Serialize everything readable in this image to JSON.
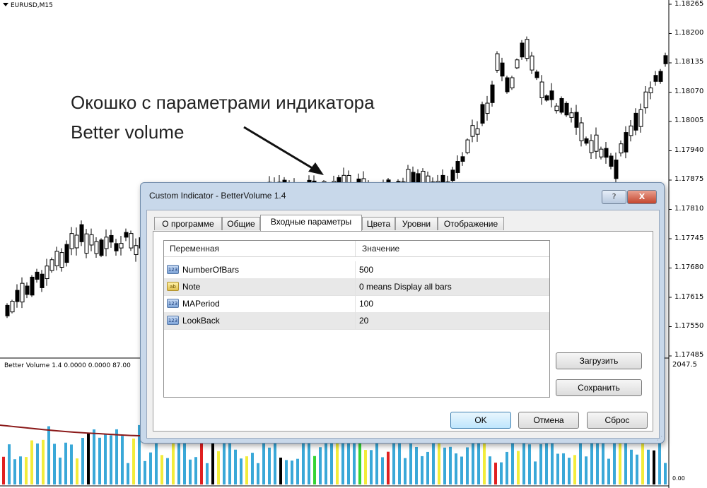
{
  "chart": {
    "symbol": "EURUSD,M15",
    "price_labels": [
      "1.18265",
      "1.18200",
      "1.18135",
      "1.18070",
      "1.18005",
      "1.17940",
      "1.17875",
      "1.17810",
      "1.17745",
      "1.17680",
      "1.17615",
      "1.17550",
      "1.17485"
    ],
    "indicator_label": "Better Volume 1.4 0.0000 0.0000 87.00",
    "indicator_right_label": "2047.5",
    "indicator_bottom_label": "0.00",
    "colors": {
      "bull": "#ffffff",
      "bear": "#000000",
      "volume_blue": "#3aa8d8",
      "volume_yellow": "#f2ec3a",
      "volume_red": "#e02020",
      "volume_green": "#35d435",
      "volume_black": "#000000",
      "ma_line": "#8b1a1a"
    }
  },
  "annotation": {
    "line1": "Окошко с параметрами индикатора",
    "line2": "Better volume"
  },
  "dialog": {
    "title": "Custom Indicator - BetterVolume 1.4",
    "help_label": "?",
    "close_label": "X",
    "tabs": [
      {
        "label": "О программе"
      },
      {
        "label": "Общие"
      },
      {
        "label": "Входные параметры",
        "active": true
      },
      {
        "label": "Цвета"
      },
      {
        "label": "Уровни"
      },
      {
        "label": "Отображение"
      }
    ],
    "grid": {
      "headers": {
        "variable": "Переменная",
        "value": "Значение"
      },
      "rows": [
        {
          "type_icon": "123",
          "name": "NumberOfBars",
          "value": "500"
        },
        {
          "type_icon": "ab",
          "name": "Note",
          "value": "0 means Display all bars"
        },
        {
          "type_icon": "123",
          "name": "MAPeriod",
          "value": "100"
        },
        {
          "type_icon": "123",
          "name": "LookBack",
          "value": "20"
        }
      ]
    },
    "buttons": {
      "load": "Загрузить",
      "save": "Сохранить",
      "ok": "OK",
      "cancel": "Отмена",
      "reset": "Сброс"
    }
  }
}
